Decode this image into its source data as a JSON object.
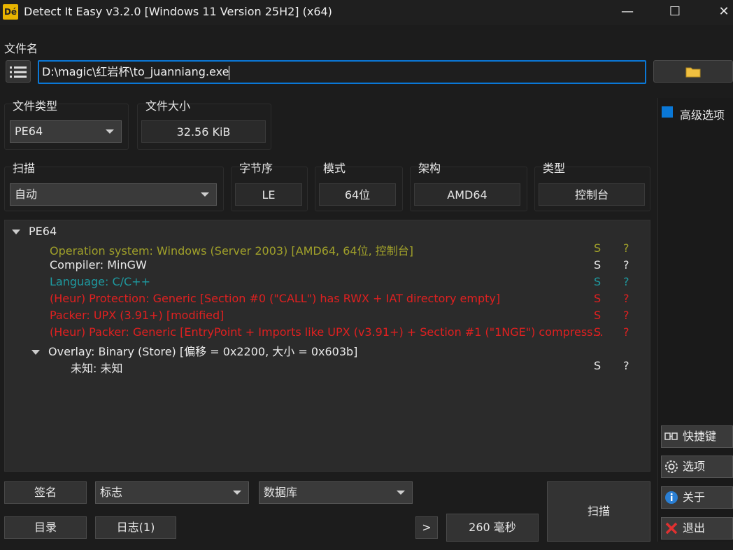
{
  "window": {
    "title": "Detect It Easy v3.2.0 [Windows 11 Version 25H2] (x64)",
    "icon_text": "Dé",
    "minimize": "—",
    "maximize": "☐",
    "close": "✕"
  },
  "file": {
    "label": "文件名",
    "path": "D:\\magic\\红岩杯\\to_juanniang.exe"
  },
  "filetype": {
    "label": "文件类型",
    "value": "PE64"
  },
  "filesize": {
    "label": "文件大小",
    "value": "32.56 KiB"
  },
  "scan": {
    "label": "扫描",
    "value": "自动"
  },
  "endian": {
    "label": "字节序",
    "value": "LE"
  },
  "mode": {
    "label": "模式",
    "value": "64位"
  },
  "arch": {
    "label": "架构",
    "value": "AMD64"
  },
  "type": {
    "label": "类型",
    "value": "控制台"
  },
  "results": {
    "root": "PE64",
    "rows": [
      {
        "text": "Operation system: Windows (Server 2003) [AMD64, 64位, 控制台]",
        "s": "S",
        "q": "?",
        "color": "#a0a02a"
      },
      {
        "text": "Compiler: MinGW",
        "s": "S",
        "q": "?",
        "color": "#eaeaea"
      },
      {
        "text": "Language: C/C++",
        "s": "S",
        "q": "?",
        "color": "#1e9aa0"
      },
      {
        "text": "(Heur) Protection: Generic [Section #0 (\"CALL\") has RWX + IAT directory empty]",
        "s": "S",
        "q": "?",
        "color": "#e02020"
      },
      {
        "text": "Packer: UPX (3.91+) [modified]",
        "s": "S",
        "q": "?",
        "color": "#e02020"
      },
      {
        "text": "(Heur) Packer: Generic [EntryPoint + Imports like UPX (v3.91+) + Section #1 (\"1NGE\") compress...",
        "s": "S",
        "q": "?",
        "color": "#e02020"
      }
    ],
    "overlay": "Overlay: Binary (Store) [偏移 = 0x2200, 大小 = 0x603b]",
    "overlay_child": {
      "text": "未知: 未知",
      "s": "S",
      "q": "?"
    }
  },
  "sidebar": {
    "advanced": "高级选项",
    "shortcuts": "快捷键",
    "options": "选项",
    "about": "关于",
    "exit": "退出"
  },
  "bottom": {
    "signature": "签名",
    "flags": "标志",
    "database": "数据库",
    "directory": "目录",
    "log": "日志(1)",
    "next": ">",
    "time": "260 毫秒",
    "scan_button": "扫描"
  },
  "colors": {
    "accent": "#0a78d7",
    "folder": "#f0c040"
  }
}
